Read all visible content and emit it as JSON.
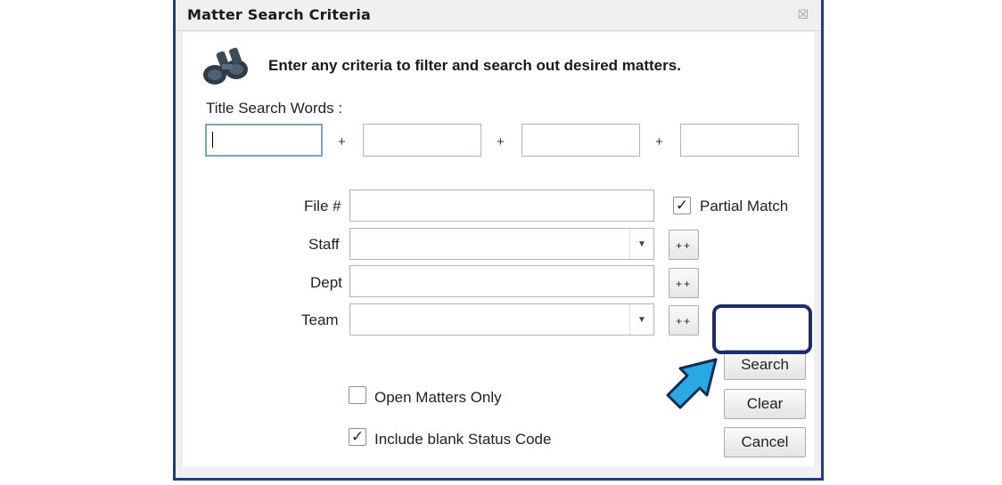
{
  "dialog": {
    "title": "Matter Search Criteria",
    "close_glyph": "☒",
    "header_text": "Enter any criteria to filter and search out desired matters.",
    "header_icon": "binoculars-icon"
  },
  "title_search": {
    "label": "Title Search Words :",
    "fields": [
      "",
      "",
      "",
      ""
    ],
    "separator": "+"
  },
  "form": {
    "file_label": "File #",
    "file_value": "",
    "partial_match_label": "Partial Match",
    "partial_match_checked": true,
    "staff_label": "Staff",
    "staff_value": "",
    "dept_label": "Dept",
    "dept_value": "",
    "team_label": "Team",
    "team_value": "",
    "plus_plus": "++"
  },
  "buttons": {
    "search": "Search",
    "clear": "Clear",
    "cancel": "Cancel"
  },
  "options": {
    "open_matters_label": "Open Matters Only",
    "open_matters_checked": false,
    "blank_status_label": "Include blank Status Code",
    "blank_status_checked": true
  },
  "colors": {
    "frame_border": "#1f3a93",
    "callout_arrow": "#29a9e1",
    "highlight_border": "#1a2d70"
  }
}
